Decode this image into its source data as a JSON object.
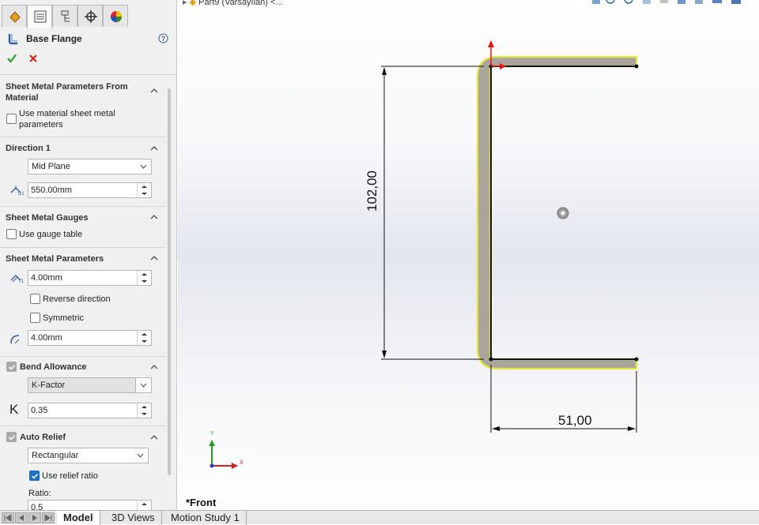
{
  "property_manager": {
    "title": "Base Flange",
    "groups": {
      "material": {
        "header": "Sheet Metal Parameters From",
        "header2": "Material",
        "checkbox_label1": "Use material sheet metal",
        "checkbox_label2": "parameters",
        "checked": false
      },
      "direction1": {
        "header": "Direction 1",
        "end_condition": "Mid Plane",
        "depth": "550.00mm"
      },
      "gauges": {
        "header": "Sheet Metal Gauges",
        "checkbox_label": "Use gauge table",
        "checked": false
      },
      "parameters": {
        "header": "Sheet Metal Parameters",
        "thickness": "4.00mm",
        "reverse_label": "Reverse direction",
        "symmetric_label": "Symmetric",
        "bend_radius": "4.00mm"
      },
      "bend_allowance": {
        "header": "Bend Allowance",
        "type": "K-Factor",
        "k_symbol": "K",
        "k_value": "0.35"
      },
      "auto_relief": {
        "header": "Auto Relief",
        "type": "Rectangular",
        "use_ratio_label": "Use relief ratio",
        "use_ratio_checked": true,
        "ratio_label": "Ratio:",
        "ratio_value": "0.5"
      }
    }
  },
  "graphics": {
    "tree_path": "Part9 (Varsayılan) <...",
    "view_label": "*Front",
    "dimensions": {
      "height": "102,00",
      "width": "51,00"
    },
    "triad": {
      "x": "X",
      "y": "Y"
    }
  },
  "bottom_tabs": [
    "Model",
    "3D Views",
    "Motion Study 1"
  ],
  "colors": {
    "selection": "#e6e640",
    "profile_fill": "#a9a59a",
    "accent_blue": "#1a6fc9",
    "ok_green": "#2a9d2a",
    "cancel_red": "#d02020"
  }
}
